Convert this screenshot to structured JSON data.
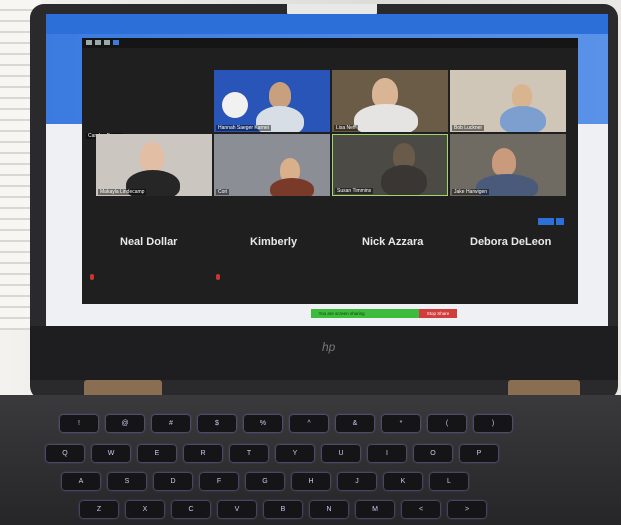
{
  "zoom": {
    "participants": [
      {
        "name": "Carolyn Brown",
        "tile_color": "#2b2b2b"
      },
      {
        "name": "Hannah Saeger Karnei",
        "tile_color": "#2a55b8"
      },
      {
        "name": "Lisa Neff",
        "tile_color": "#6b5c48"
      },
      {
        "name": "Bob Luckner",
        "tile_color": "#cfc6b8"
      },
      {
        "name": "Makayla Lindecamp",
        "tile_color": "#ccc6c0"
      },
      {
        "name": "Cori",
        "tile_color": "#8b8f95"
      },
      {
        "name": "Susan Timmins",
        "tile_color": "#4c4a44"
      },
      {
        "name": "Jake Harwigen",
        "tile_color": "#6f6a62"
      }
    ],
    "audio_only": [
      "Neal Dollar",
      "Kimberly",
      "Nick Azzara",
      "Debora DeLeon"
    ],
    "share_notice": "You are screen sharing",
    "stop_share": "Stop Share"
  },
  "laptop": {
    "brand": "hp"
  },
  "keyboard_rows": [
    [
      "!",
      "@",
      "#",
      "$",
      "%",
      "^",
      "&",
      "*",
      "(",
      ")"
    ],
    [
      "Q",
      "W",
      "E",
      "R",
      "T",
      "Y",
      "U",
      "I",
      "O",
      "P"
    ],
    [
      "A",
      "S",
      "D",
      "F",
      "G",
      "H",
      "J",
      "K",
      "L"
    ],
    [
      "Z",
      "X",
      "C",
      "V",
      "B",
      "N",
      "M",
      "<",
      ">"
    ]
  ]
}
